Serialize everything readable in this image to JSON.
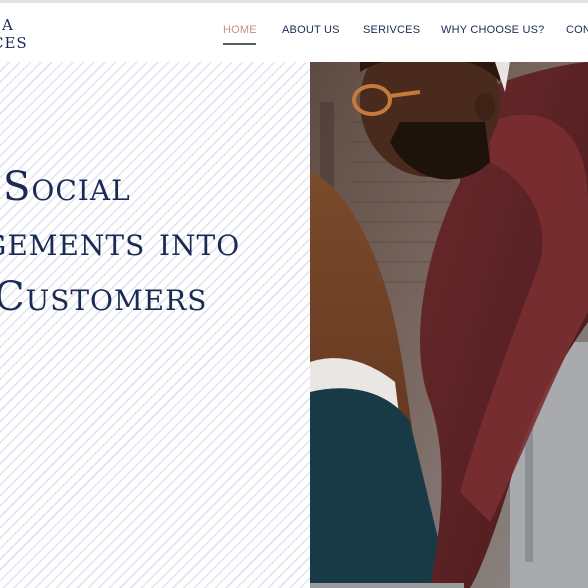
{
  "brand": {
    "line1": "A",
    "line2": "CES"
  },
  "nav": {
    "items": [
      {
        "label": "HOME",
        "active": true
      },
      {
        "label": "ABOUT US",
        "active": false
      },
      {
        "label": "SERIVCES",
        "active": false
      },
      {
        "label": "WHY CHOOSE US?",
        "active": false
      },
      {
        "label": "CON",
        "active": false
      }
    ]
  },
  "hero": {
    "headline_lines": [
      "Social",
      "gements into",
      "Customers"
    ]
  },
  "colors": {
    "navy": "#1b2a55",
    "active_nav": "#c88f8a",
    "stripe": "#e1e4ee"
  },
  "icons": {
    "photo": "people-working-photo"
  }
}
